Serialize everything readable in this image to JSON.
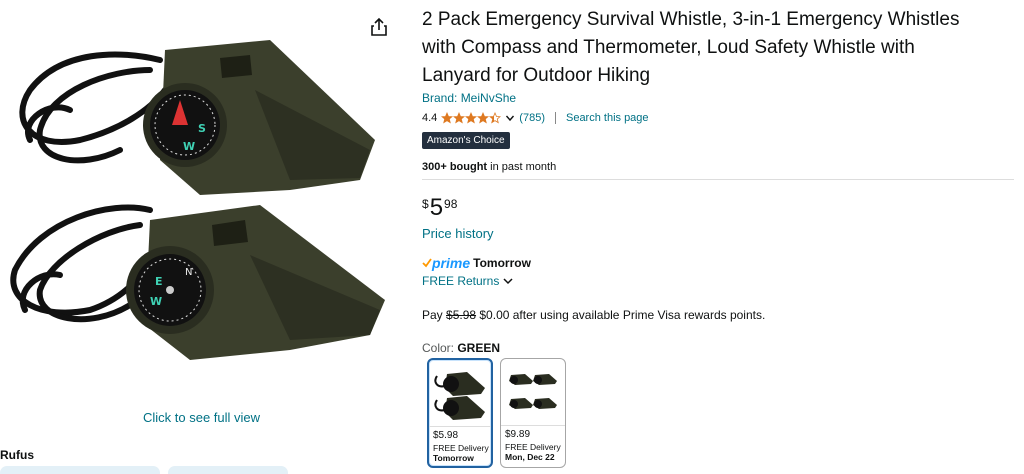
{
  "image_pane": {
    "share_icon": "share-icon",
    "see_full_view": "Click to see full view",
    "rufus_label": "Rufus"
  },
  "product": {
    "title": "2 Pack Emergency Survival Whistle, 3-in-1 Emergency Whistles with Compass and Thermometer, Loud Safety Whistle with Lanyard for Outdoor Hiking",
    "brand": "Brand: MeiNvShe",
    "rating": "4.4",
    "rating_stars_value": 4.4,
    "rating_count": "(785)",
    "search_page": "Search this page",
    "badge": "Amazon's Choice",
    "bought_bold": "300+ bought",
    "bought_rest": " in past month",
    "price_currency": "$",
    "price_whole": "5",
    "price_fraction": "98",
    "price_history": "Price history",
    "prime_word": "prime",
    "prime_delivery": "Tomorrow",
    "free_returns": "FREE Returns",
    "pay_prefix": "Pay ",
    "pay_strike": "$5.98",
    "pay_rest": " $0.00 after using available Prime Visa rewards points.",
    "color_label": "Color: ",
    "color_value": "GREEN"
  },
  "swatches": [
    {
      "price": "$5.98",
      "delivery": "FREE Delivery",
      "date": "Tomorrow",
      "selected": true
    },
    {
      "price": "$9.89",
      "delivery": "FREE Delivery",
      "date": "Mon, Dec 22",
      "selected": false
    }
  ],
  "colors": {
    "link": "#007185",
    "star": "#de7921",
    "badge_bg": "#232f3e",
    "prime_blue": "#1a98ff",
    "whistle": "#3b3f2c"
  }
}
